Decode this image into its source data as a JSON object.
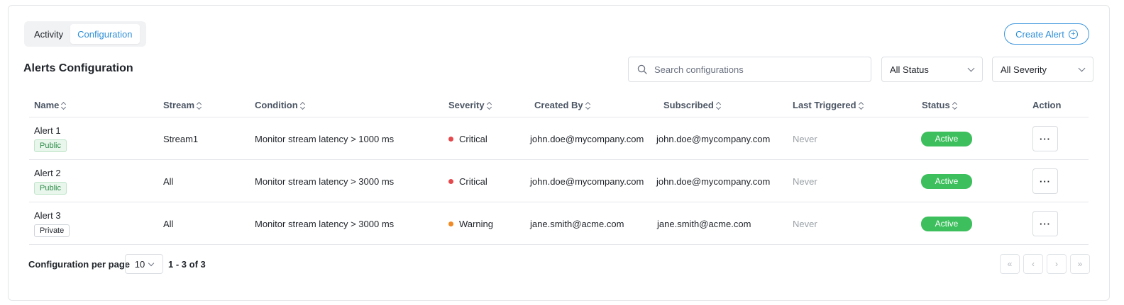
{
  "tabs": [
    {
      "label": "Activity"
    },
    {
      "label": "Configuration"
    }
  ],
  "create_button": {
    "label": "Create Alert"
  },
  "section_title": "Alerts Configuration",
  "search": {
    "placeholder": "Search configurations",
    "value": ""
  },
  "filters": {
    "status": {
      "selected": "All Status"
    },
    "severity": {
      "selected": "All Severity"
    }
  },
  "columns": [
    "Name",
    "Stream",
    "Condition",
    "Severity",
    "Created By",
    "Subscribed",
    "Last Triggered",
    "Status",
    "Action"
  ],
  "rows": [
    {
      "name": "Alert 1",
      "visibility": "Public",
      "stream": "Stream1",
      "condition": "Monitor stream latency > 1000 ms",
      "severity": "Critical",
      "created_by": "john.doe@mycompany.com",
      "subscribed": "john.doe@mycompany.com",
      "last_triggered": "Never",
      "status": "Active",
      "action": "···"
    },
    {
      "name": "Alert 2",
      "visibility": "Public",
      "stream": "All",
      "condition": "Monitor stream latency > 3000 ms",
      "severity": "Critical",
      "created_by": "john.doe@mycompany.com",
      "subscribed": "john.doe@mycompany.com",
      "last_triggered": "Never",
      "status": "Active",
      "action": "···"
    },
    {
      "name": "Alert 3",
      "visibility": "Private",
      "stream": "All",
      "condition": "Monitor stream latency > 3000 ms",
      "severity": "Warning",
      "created_by": "jane.smith@acme.com",
      "subscribed": "jane.smith@acme.com",
      "last_triggered": "Never",
      "status": "Active",
      "action": "···"
    }
  ],
  "colors": {
    "accent": "#2f8fd8",
    "critical": "#e5484d",
    "warning": "#f08a24",
    "active": "#3cbf5c"
  },
  "pagination": {
    "per_page_label": "Configuration per page",
    "per_page_value": "10",
    "range": "1 - 3 of 3",
    "buttons": [
      "«",
      "‹",
      "›",
      "»"
    ]
  }
}
